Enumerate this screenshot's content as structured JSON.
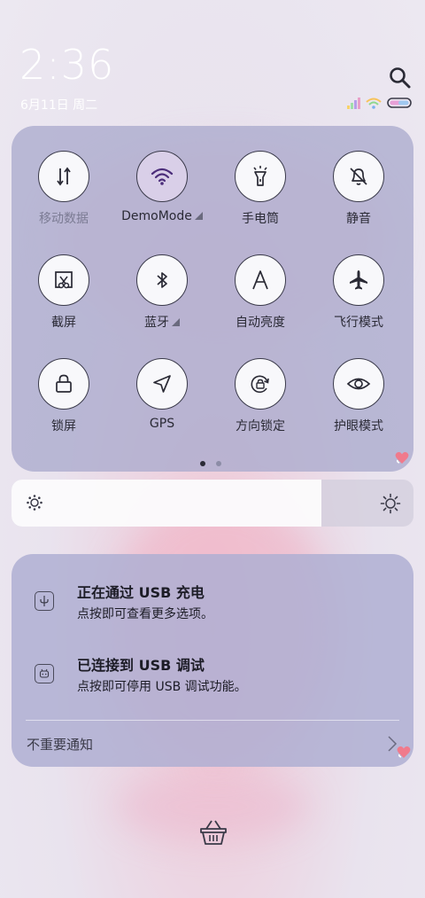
{
  "status_bar": {
    "time": "2:36",
    "date": "6月11日 周二",
    "search_icon": "search-icon"
  },
  "quick_settings": {
    "tiles": [
      {
        "label": "移动数据",
        "icon": "mobile-data-icon",
        "active": false,
        "dim": true,
        "has_menu": false
      },
      {
        "label": "DemoMode",
        "icon": "wifi-icon",
        "active": true,
        "dim": false,
        "has_menu": true
      },
      {
        "label": "手电筒",
        "icon": "flashlight-icon",
        "active": false,
        "dim": false,
        "has_menu": false
      },
      {
        "label": "静音",
        "icon": "bell-off-icon",
        "active": false,
        "dim": false,
        "has_menu": false
      },
      {
        "label": "截屏",
        "icon": "screenshot-icon",
        "active": false,
        "dim": false,
        "has_menu": false
      },
      {
        "label": "蓝牙",
        "icon": "bluetooth-icon",
        "active": false,
        "dim": false,
        "has_menu": true
      },
      {
        "label": "自动亮度",
        "icon": "auto-brightness-icon",
        "active": false,
        "dim": false,
        "has_menu": false
      },
      {
        "label": "飞行模式",
        "icon": "airplane-icon",
        "active": false,
        "dim": false,
        "has_menu": false
      },
      {
        "label": "锁屏",
        "icon": "lock-icon",
        "active": false,
        "dim": false,
        "has_menu": false
      },
      {
        "label": "GPS",
        "icon": "gps-icon",
        "active": false,
        "dim": false,
        "has_menu": false
      },
      {
        "label": "方向锁定",
        "icon": "rotation-lock-icon",
        "active": false,
        "dim": false,
        "has_menu": false
      },
      {
        "label": "护眼模式",
        "icon": "eye-icon",
        "active": false,
        "dim": false,
        "has_menu": false
      }
    ],
    "page_count": 2,
    "current_page": 1
  },
  "brightness": {
    "level": 0.77,
    "low_icon": "brightness-low-icon",
    "high_icon": "brightness-high-icon"
  },
  "notifications": {
    "items": [
      {
        "title": "正在通过 USB 充电",
        "subtitle": "点按即可查看更多选项。",
        "icon": "usb-icon"
      },
      {
        "title": "已连接到 USB 调试",
        "subtitle": "点按即可停用 USB 调试功能。",
        "icon": "android-debug-icon"
      }
    ],
    "footer_label": "不重要通知"
  },
  "colors": {
    "panel": "#aaaacd",
    "accent_wifi": "#4b2d7a",
    "text": "#2a2a35"
  }
}
